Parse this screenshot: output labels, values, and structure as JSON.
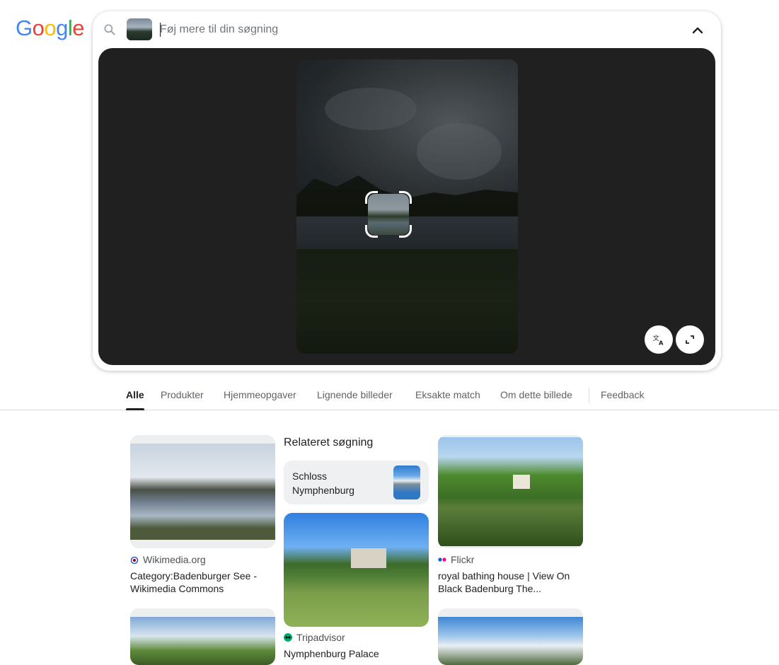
{
  "logo": {
    "text": [
      "G",
      "o",
      "o",
      "g",
      "l",
      "e"
    ],
    "colors": [
      "#4285F4",
      "#EA4335",
      "#FBBC05",
      "#4285F4",
      "#34A853",
      "#EA4335"
    ]
  },
  "search": {
    "placeholder": "Føj mere til din søgning",
    "value": ""
  },
  "tabs": [
    "Alle",
    "Produkter",
    "Hjemmeopgaver",
    "Lignende billeder",
    "Eksakte match",
    "Om dette billede",
    "Feedback"
  ],
  "active_tab": "Alle",
  "results": {
    "related_heading": "Relateret søgning",
    "related_chip": "Schloss Nymphenburg",
    "cards": [
      {
        "source": "Wikimedia.org",
        "title": "Category:Badenburger See - Wikimedia Commons"
      },
      {
        "source": "Tripadvisor",
        "title": "Nymphenburg Palace"
      },
      {
        "source": "Flickr",
        "title": "royal bathing house | View On Black Badenburg The..."
      }
    ]
  },
  "icons": {
    "search": "search-icon",
    "collapse": "chevron-up-icon",
    "translate": "translate-icon",
    "expand": "expand-icon",
    "lens": "lens-target-icon"
  },
  "colors": {
    "viewer_bg": "#202020",
    "tab_active": "#202124",
    "text_secondary": "#5f6368"
  }
}
